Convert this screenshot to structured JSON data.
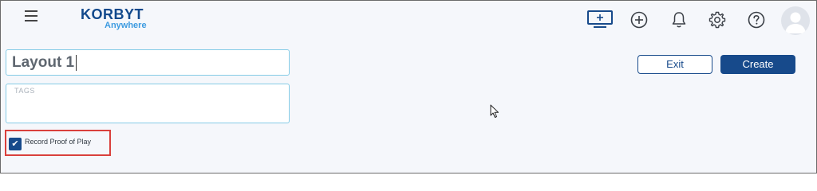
{
  "header": {
    "menu_icon": "hamburger-menu-icon",
    "logo": {
      "wordmark": "KORBYT",
      "subtitle": "Anywhere"
    },
    "icons": [
      "display-screen-icon",
      "add-circle-icon",
      "bell-icon",
      "gear-icon",
      "help-icon",
      "avatar-icon"
    ]
  },
  "form": {
    "layout_name_value": "Layout 1",
    "tags_placeholder": "TAGS",
    "record_proof_of_play": {
      "label": "Record Proof of Play",
      "checked": true
    }
  },
  "actions": {
    "exit_label": "Exit",
    "create_label": "Create"
  },
  "colors": {
    "brand_navy": "#174a8b",
    "brand_light_blue": "#3d9be0",
    "field_border": "#85cbe6",
    "highlight_red": "#d9403c",
    "background": "#f5f7fb"
  }
}
